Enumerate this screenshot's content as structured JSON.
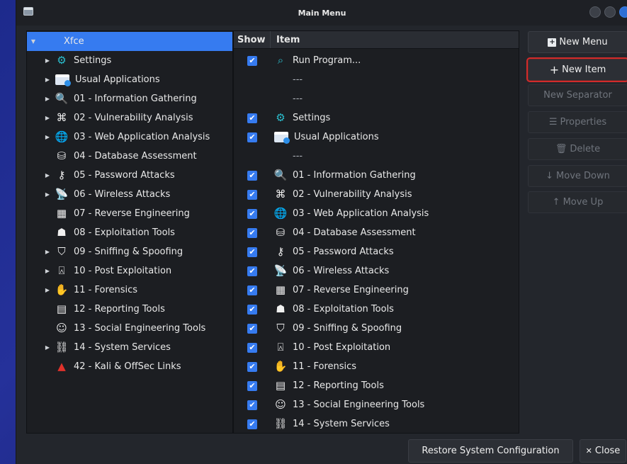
{
  "window": {
    "title": "Main Menu"
  },
  "tree": {
    "root": "Xfce",
    "items": [
      {
        "label": "Settings",
        "icon": "settings-icon",
        "glyph": "⚙",
        "expandable": true
      },
      {
        "label": "Usual Applications",
        "icon": "folder-icon",
        "glyph": "",
        "expandable": true
      },
      {
        "label": "01 - Information Gathering",
        "icon": "magnifier-icon",
        "glyph": "🔍",
        "expandable": true
      },
      {
        "label": "02 - Vulnerability Analysis",
        "icon": "vulnerability-icon",
        "glyph": "⌘",
        "expandable": true
      },
      {
        "label": "03 - Web Application Analysis",
        "icon": "globe-icon",
        "glyph": "🌐",
        "expandable": true
      },
      {
        "label": "04 - Database Assessment",
        "icon": "database-icon",
        "glyph": "⛁",
        "expandable": false
      },
      {
        "label": "05 - Password Attacks",
        "icon": "key-icon",
        "glyph": "⚷",
        "expandable": true
      },
      {
        "label": "06 - Wireless Attacks",
        "icon": "wireless-icon",
        "glyph": "📡",
        "expandable": true
      },
      {
        "label": "07 - Reverse Engineering",
        "icon": "reverse-engineering-icon",
        "glyph": "▦",
        "expandable": false
      },
      {
        "label": "08 - Exploitation Tools",
        "icon": "exploit-icon",
        "glyph": "☗",
        "expandable": false
      },
      {
        "label": "09 - Sniffing & Spoofing",
        "icon": "sniffing-icon",
        "glyph": "⛉",
        "expandable": true
      },
      {
        "label": "10 - Post Exploitation",
        "icon": "post-exploitation-icon",
        "glyph": "⍓",
        "expandable": true
      },
      {
        "label": "11 - Forensics",
        "icon": "hand-icon",
        "glyph": "✋",
        "expandable": true
      },
      {
        "label": "12 - Reporting Tools",
        "icon": "report-icon",
        "glyph": "▤",
        "expandable": false
      },
      {
        "label": "13 - Social Engineering Tools",
        "icon": "social-engineering-icon",
        "glyph": "☺",
        "expandable": false
      },
      {
        "label": "14 - System Services",
        "icon": "services-icon",
        "glyph": "⛓",
        "expandable": true
      },
      {
        "label": "42 - Kali & OffSec Links",
        "icon": "kali-icon",
        "glyph": "▲",
        "expandable": false
      }
    ]
  },
  "list": {
    "header_show": "Show",
    "header_item": "Item",
    "rows": [
      {
        "type": "item",
        "checked": true,
        "label": "Run Program...",
        "icon": "run-program-icon",
        "glyph": "⌕"
      },
      {
        "type": "sep",
        "label": "---"
      },
      {
        "type": "sep",
        "label": "---"
      },
      {
        "type": "item",
        "checked": true,
        "label": "Settings",
        "icon": "settings-icon",
        "glyph": "⚙"
      },
      {
        "type": "item",
        "checked": true,
        "label": "Usual Applications",
        "icon": "folder-icon",
        "glyph": ""
      },
      {
        "type": "sep",
        "label": "---"
      },
      {
        "type": "item",
        "checked": true,
        "label": "01 - Information Gathering",
        "icon": "magnifier-icon",
        "glyph": "🔍"
      },
      {
        "type": "item",
        "checked": true,
        "label": "02 - Vulnerability Analysis",
        "icon": "vulnerability-icon",
        "glyph": "⌘"
      },
      {
        "type": "item",
        "checked": true,
        "label": "03 - Web Application Analysis",
        "icon": "globe-icon",
        "glyph": "🌐"
      },
      {
        "type": "item",
        "checked": true,
        "label": "04 - Database Assessment",
        "icon": "database-icon",
        "glyph": "⛁"
      },
      {
        "type": "item",
        "checked": true,
        "label": "05 - Password Attacks",
        "icon": "key-icon",
        "glyph": "⚷"
      },
      {
        "type": "item",
        "checked": true,
        "label": "06 - Wireless Attacks",
        "icon": "wireless-icon",
        "glyph": "📡"
      },
      {
        "type": "item",
        "checked": true,
        "label": "07 - Reverse Engineering",
        "icon": "reverse-engineering-icon",
        "glyph": "▦"
      },
      {
        "type": "item",
        "checked": true,
        "label": "08 - Exploitation Tools",
        "icon": "exploit-icon",
        "glyph": "☗"
      },
      {
        "type": "item",
        "checked": true,
        "label": "09 - Sniffing & Spoofing",
        "icon": "sniffing-icon",
        "glyph": "⛉"
      },
      {
        "type": "item",
        "checked": true,
        "label": "10 - Post Exploitation",
        "icon": "post-exploitation-icon",
        "glyph": "⍓"
      },
      {
        "type": "item",
        "checked": true,
        "label": "11 - Forensics",
        "icon": "hand-icon",
        "glyph": "✋"
      },
      {
        "type": "item",
        "checked": true,
        "label": "12 - Reporting Tools",
        "icon": "report-icon",
        "glyph": "▤"
      },
      {
        "type": "item",
        "checked": true,
        "label": "13 - Social Engineering Tools",
        "icon": "social-engineering-icon",
        "glyph": "☺"
      },
      {
        "type": "item",
        "checked": true,
        "label": "14 - System Services",
        "icon": "services-icon",
        "glyph": "⛓"
      }
    ]
  },
  "actions": {
    "new_menu": "New Menu",
    "new_item": "New Item",
    "new_separator": "New Separator",
    "properties": "Properties",
    "delete": "Delete",
    "move_down": "Move Down",
    "move_up": "Move Up"
  },
  "footer": {
    "restore": "Restore System Configuration",
    "close": "Close"
  },
  "colors": {
    "accent": "#367bf0",
    "highlight_outline": "#d22b2b",
    "window_bg": "#23262c"
  }
}
